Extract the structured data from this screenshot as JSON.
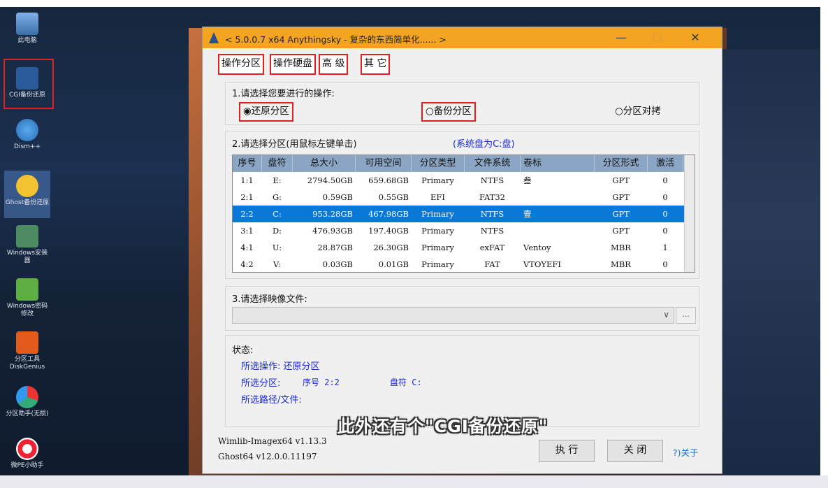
{
  "desktop": {
    "icons": [
      {
        "label": "此电脑"
      },
      {
        "label": "CGI备份还原"
      },
      {
        "label": "Dism++"
      },
      {
        "label": "Ghost备份还原"
      },
      {
        "label": "Windows安装器"
      },
      {
        "label": "Windows密码修改"
      },
      {
        "label": "分区工具DiskGenius"
      },
      {
        "label": "分区助手(无损)"
      },
      {
        "label": "微PE小助手"
      }
    ]
  },
  "window": {
    "title": "< 5.0.0.7 x64 Anythingsky - 复杂的东西简单化...... >",
    "min": "—",
    "max": "☐",
    "close": "✕",
    "tabs": [
      "操作分区",
      "操作硬盘",
      "高 级",
      "其 它"
    ],
    "section1": {
      "title": "1.请选择您要进行的操作:",
      "options": [
        "◉还原分区",
        "○备份分区",
        "○分区对拷"
      ]
    },
    "section2": {
      "title": "2.请选择分区(用鼠标左键单击)",
      "sys_note": "(系统盘为C:盘)",
      "headers": [
        "序号",
        "盘符",
        "总大小",
        "可用空间",
        "分区类型",
        "文件系统",
        "卷标",
        "分区形式",
        "激活"
      ],
      "rows": [
        [
          "1:1",
          "E:",
          "2794.50GB",
          "659.68GB",
          "Primary",
          "NTFS",
          "叁",
          "GPT",
          "0"
        ],
        [
          "2:1",
          "G:",
          "0.59GB",
          "0.55GB",
          "EFI",
          "FAT32",
          "",
          "GPT",
          "0"
        ],
        [
          "2:2",
          "C:",
          "953.28GB",
          "467.98GB",
          "Primary",
          "NTFS",
          "壹",
          "GPT",
          "0"
        ],
        [
          "3:1",
          "D:",
          "476.93GB",
          "197.40GB",
          "Primary",
          "NTFS",
          "",
          "GPT",
          "0"
        ],
        [
          "4:1",
          "U:",
          "28.87GB",
          "26.30GB",
          "Primary",
          "exFAT",
          "Ventoy",
          "MBR",
          "1"
        ],
        [
          "4:2",
          "V:",
          "0.03GB",
          "0.01GB",
          "Primary",
          "FAT",
          "VTOYEFI",
          "MBR",
          "0"
        ]
      ]
    },
    "section3": {
      "title": "3.请选择映像文件:",
      "combo_value": "",
      "browse": "..."
    },
    "status": {
      "title": "状态:",
      "op": "所选操作: 还原分区",
      "part": "所选分区:",
      "part_seq": "序号 2:2",
      "part_drive": "盘符 C:",
      "path": "所选路径/文件:"
    },
    "footer": {
      "wimlib": "Wimlib-Imagex64 v1.13.3",
      "ghost": "Ghost64 v12.0.0.11197",
      "exec": "执 行",
      "close": "关 闭",
      "about": "?)关于"
    }
  },
  "subtitle": "此外还有个\"CGI备份还原\""
}
